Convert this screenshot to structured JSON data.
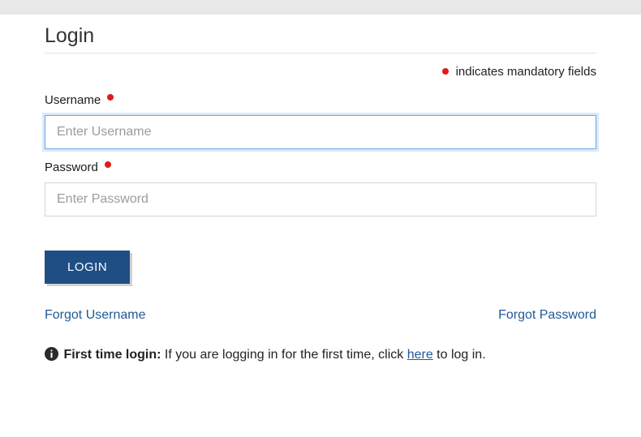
{
  "page": {
    "title": "Login"
  },
  "mandatory": {
    "text": "indicates mandatory fields"
  },
  "fields": {
    "username": {
      "label": "Username",
      "placeholder": "Enter Username",
      "value": ""
    },
    "password": {
      "label": "Password",
      "placeholder": "Enter Password",
      "value": ""
    }
  },
  "buttons": {
    "login": "LOGIN"
  },
  "links": {
    "forgot_username": "Forgot Username",
    "forgot_password": "Forgot Password",
    "here": "here"
  },
  "info": {
    "bold": "First time login:",
    "text_before_link": " If you are logging in for the first time, click ",
    "text_after_link": " to log in."
  }
}
